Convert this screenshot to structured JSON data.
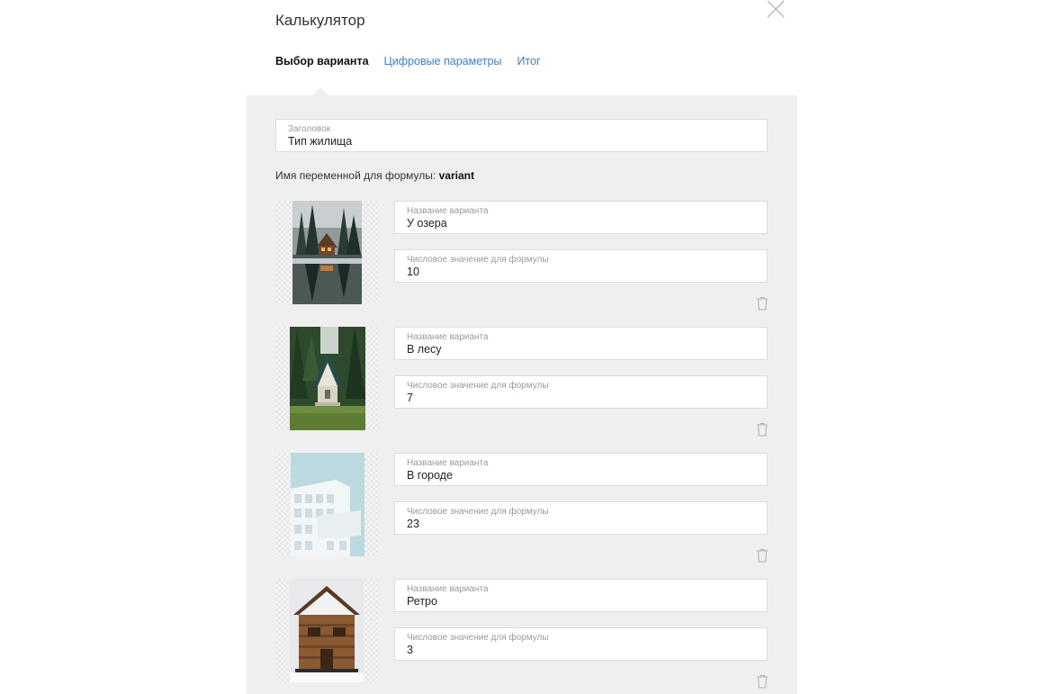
{
  "dialog": {
    "title": "Калькулятор"
  },
  "tabs": [
    {
      "label": "Выбор варианта"
    },
    {
      "label": "Цифровые параметры"
    },
    {
      "label": "Итог"
    }
  ],
  "header_field": {
    "label": "Заголовок",
    "value": "Тип жилища"
  },
  "formula": {
    "prefix": "Имя переменной для формулы: ",
    "variable": "variant"
  },
  "variant_labels": {
    "name": "Название варианта",
    "number": "Числовое значение для формулы"
  },
  "variants": [
    {
      "name": "У озера",
      "value": "10",
      "image": "lake-cabin-image"
    },
    {
      "name": "В лесу",
      "value": "7",
      "image": "forest-house-image"
    },
    {
      "name": "В городе",
      "value": "23",
      "image": "city-building-image"
    },
    {
      "name": "Ретро",
      "value": "3",
      "image": "retro-wooden-house-image"
    }
  ],
  "colors": {
    "link": "#3b7fd6",
    "panel": "#efefef"
  }
}
